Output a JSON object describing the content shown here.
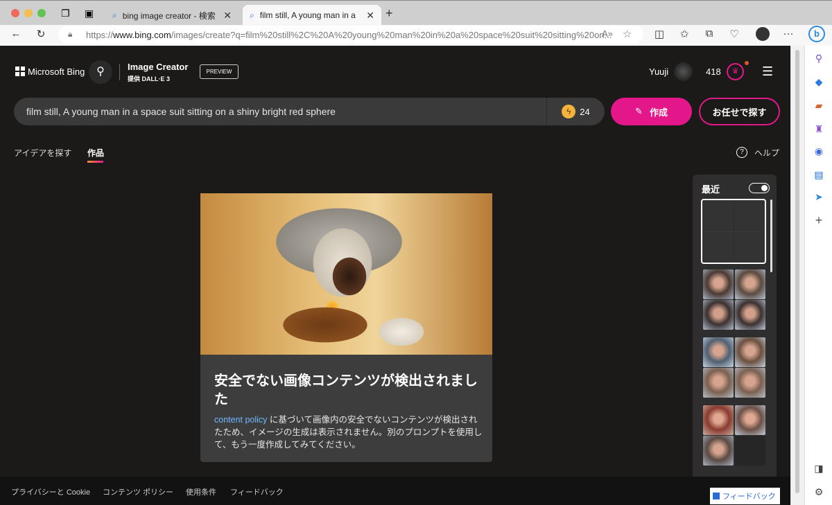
{
  "browser": {
    "tabs": [
      {
        "label": "bing image creator - 検索"
      },
      {
        "label": "film still, A young man in a spac"
      }
    ],
    "url_prefix": "https://",
    "url_domain": "www.bing.com",
    "url_path": "/images/create?q=film%20still%2C%20A%20young%20man%20in%20a%20space%20suit%20sitting%20on..."
  },
  "header": {
    "brand": "Microsoft Bing",
    "title": "Image Creator",
    "subtitle": "提供 DALL·E 3",
    "badge": "PREVIEW",
    "user": "Yuuji",
    "points": "418"
  },
  "prompt": {
    "value": "film still, A young man in a space suit sitting on a shiny bright red sphere",
    "boosts": "24",
    "create_label": "作成",
    "surprise_label": "お任せで探す"
  },
  "tabs": [
    {
      "label": "アイデアを探す"
    },
    {
      "label": "作品"
    }
  ],
  "help_label": "ヘルプ",
  "result": {
    "title": "安全でない画像コンテンツが検出されました",
    "link": "content policy",
    "body": " に基づいて画像内の安全でないコンテンツが検出されたため、イメージの生成は表示されません。別のプロンプトを使用して、もう一度作成してみてください。"
  },
  "recent": {
    "label": "最近",
    "toggle_on": true
  },
  "footer": {
    "links": [
      "プライバシーと Cookie",
      "コンテンツ ポリシー",
      "使用条件",
      "フィードバック"
    ],
    "feedback_button": "フィードバック"
  },
  "colors": {
    "accent": "#e3178a",
    "link": "#6fb8ff"
  }
}
